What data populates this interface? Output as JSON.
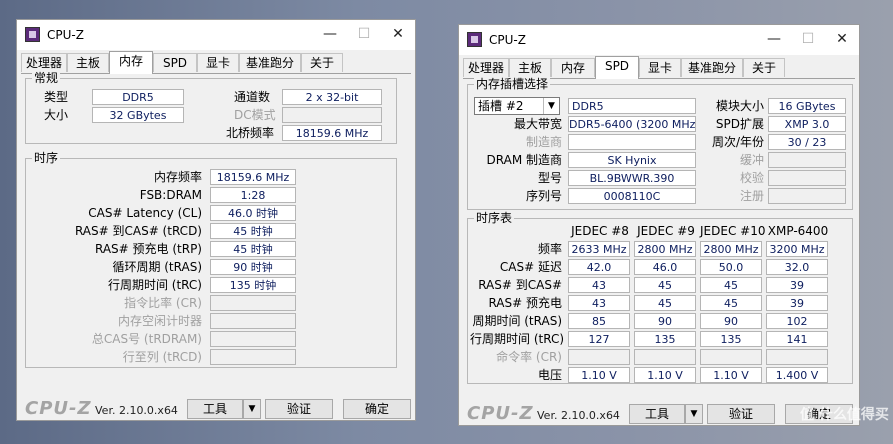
{
  "w1": {
    "title": "CPU-Z",
    "tabs": [
      "处理器",
      "主板",
      "内存",
      "SPD",
      "显卡",
      "基准跑分",
      "关于"
    ],
    "general": {
      "title": "常规",
      "type_label": "类型",
      "type_value": "DDR5",
      "size_label": "大小",
      "size_value": "32 GBytes",
      "channels_label": "通道数",
      "channels_value": "2 x 32-bit",
      "dc_label": "DC模式",
      "nb_label": "北桥频率",
      "nb_value": "18159.6 MHz"
    },
    "timing": {
      "title": "时序",
      "rows": [
        {
          "label": "内存频率",
          "value": "18159.6 MHz"
        },
        {
          "label": "FSB:DRAM",
          "value": "1:28"
        },
        {
          "label": "CAS# Latency (CL)",
          "value": "46.0 时钟"
        },
        {
          "label": "RAS# 到CAS# (tRCD)",
          "value": "45 时钟"
        },
        {
          "label": "RAS# 预充电 (tRP)",
          "value": "45 时钟"
        },
        {
          "label": "循环周期 (tRAS)",
          "value": "90 时钟"
        },
        {
          "label": "行周期时间 (tRC)",
          "value": "135 时钟"
        },
        {
          "label": "指令比率 (CR)",
          "value": ""
        },
        {
          "label": "内存空闲计时器",
          "value": ""
        },
        {
          "label": "总CAS号 (tRDRAM)",
          "value": ""
        },
        {
          "label": "行至列 (tRCD)",
          "value": ""
        }
      ]
    },
    "footer": {
      "logo": "CPU-Z",
      "version": "Ver. 2.10.0.x64",
      "tools": "工具",
      "validate": "验证",
      "ok": "确定"
    }
  },
  "w2": {
    "title": "CPU-Z",
    "tabs": [
      "处理器",
      "主板",
      "内存",
      "SPD",
      "显卡",
      "基准跑分",
      "关于"
    ],
    "slot": {
      "title": "内存插槽选择",
      "slot_value": "插槽 #2",
      "type_value": "DDR5",
      "module_size_label": "模块大小",
      "module_size_value": "16 GBytes",
      "max_bw_label": "最大带宽",
      "max_bw_value": "DDR5-6400 (3200 MHz)",
      "spd_ext_label": "SPD扩展",
      "spd_ext_value": "XMP 3.0",
      "mfr_label": "制造商",
      "week_year_label": "周次/年份",
      "week_year_value": "30 / 23",
      "dram_mfr_label": "DRAM 制造商",
      "dram_mfr_value": "SK Hynix",
      "buffer_label": "缓冲",
      "model_label": "型号",
      "model_value": "BL.9BWWR.390",
      "check_label": "校验",
      "serial_label": "序列号",
      "serial_value": "0008110C",
      "reg_label": "注册"
    },
    "timing_table": {
      "title": "时序表",
      "columns": [
        "JEDEC #8",
        "JEDEC #9",
        "JEDEC #10",
        "XMP-6400"
      ],
      "rows": [
        {
          "label": "频率",
          "values": [
            "2633 MHz",
            "2800 MHz",
            "2800 MHz",
            "3200 MHz"
          ]
        },
        {
          "label": "CAS# 延迟",
          "values": [
            "42.0",
            "46.0",
            "50.0",
            "32.0"
          ]
        },
        {
          "label": "RAS# 到CAS#",
          "values": [
            "43",
            "45",
            "45",
            "39"
          ]
        },
        {
          "label": "RAS# 预充电",
          "values": [
            "43",
            "45",
            "45",
            "39"
          ]
        },
        {
          "label": "周期时间 (tRAS)",
          "values": [
            "85",
            "90",
            "90",
            "102"
          ]
        },
        {
          "label": "行周期时间 (tRC)",
          "values": [
            "127",
            "135",
            "135",
            "141"
          ]
        },
        {
          "label": "命令率 (CR)",
          "values": [
            "",
            "",
            "",
            ""
          ]
        },
        {
          "label": "电压",
          "values": [
            "1.10 V",
            "1.10 V",
            "1.10 V",
            "1.400 V"
          ]
        }
      ]
    },
    "footer": {
      "logo": "CPU-Z",
      "version": "Ver. 2.10.0.x64",
      "tools": "工具",
      "validate": "验证",
      "ok": "确定"
    }
  },
  "icons": {
    "minimize": "minimize-icon",
    "maximize": "maximize-icon",
    "close": "close-icon"
  },
  "watermark": "值 什么值得买"
}
